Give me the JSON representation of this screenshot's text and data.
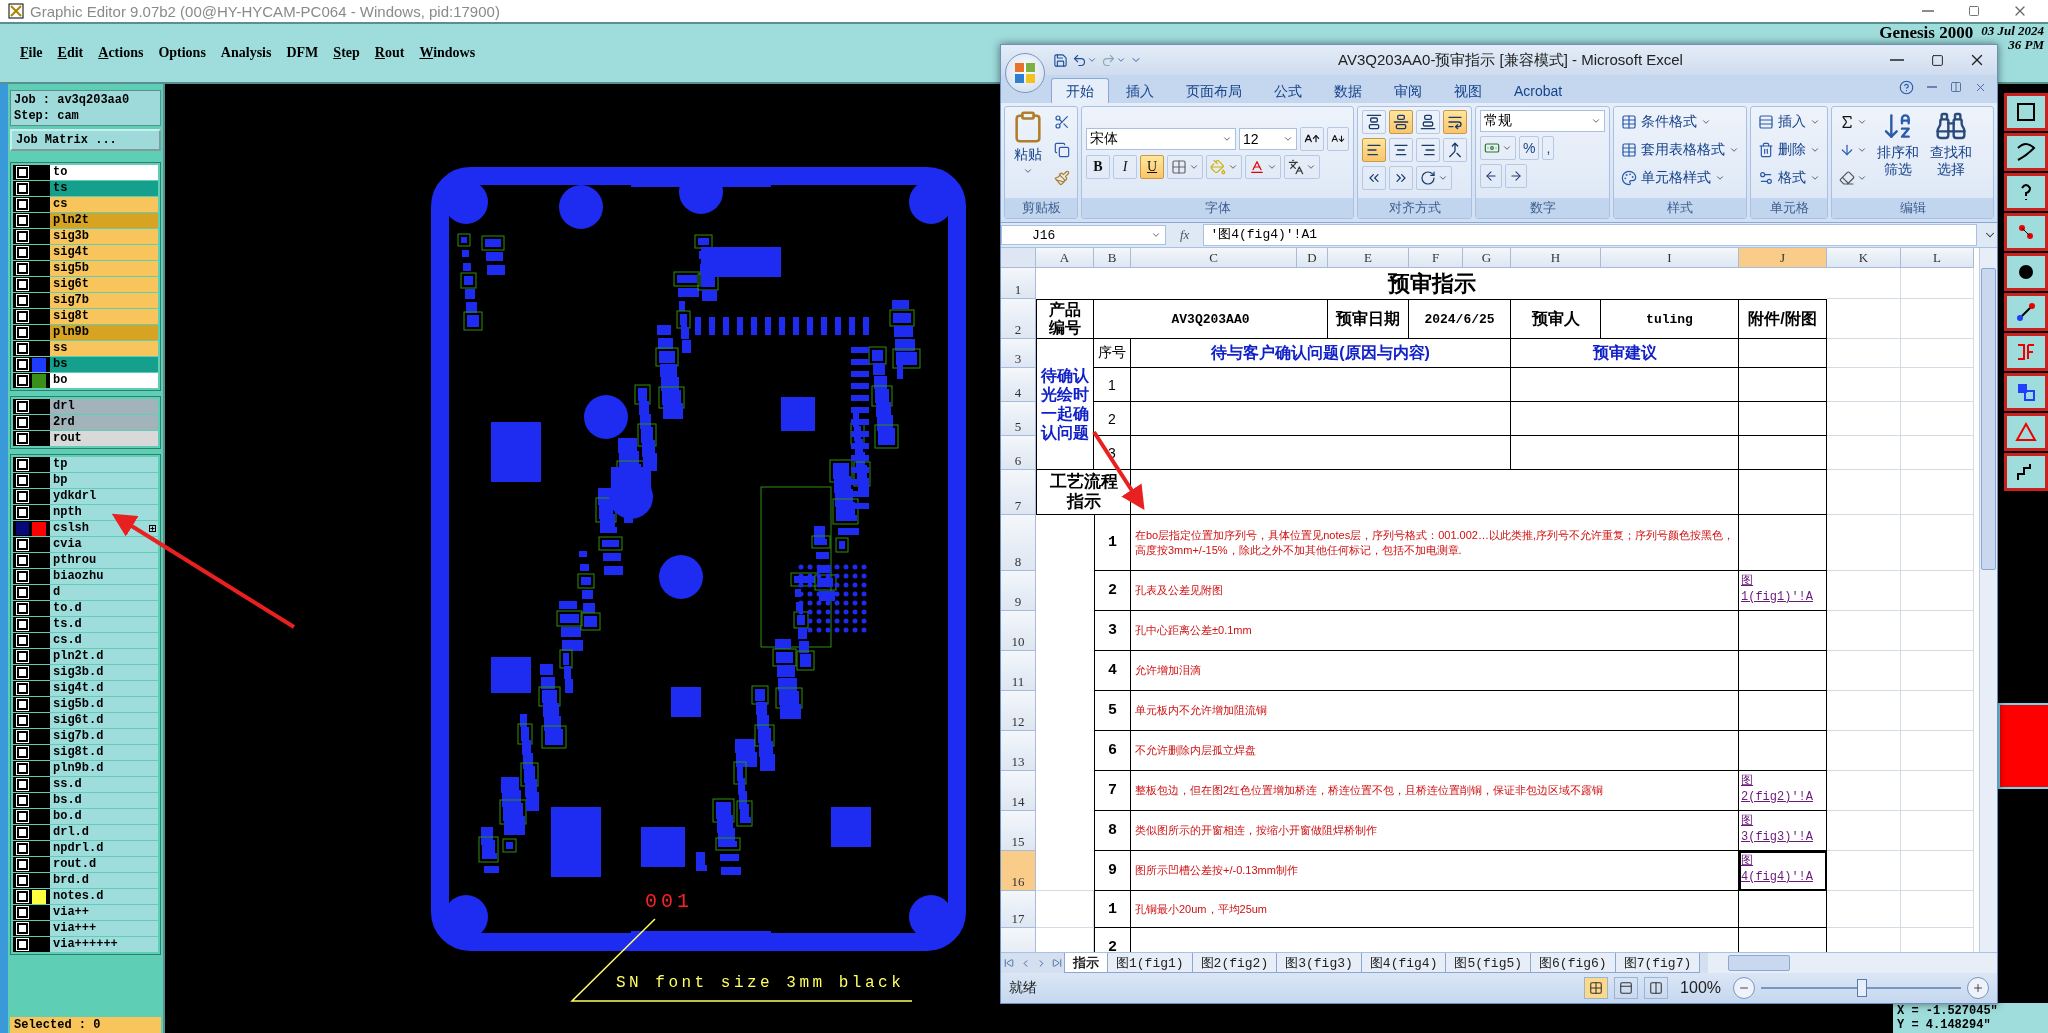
{
  "genesis": {
    "title": "Graphic Editor 9.07b2 (00@HY-HYCAM-PC064 - Windows, pid:17900)",
    "menu": [
      {
        "label": "File",
        "underlined": true
      },
      {
        "label": "Edit",
        "underlined": true
      },
      {
        "label": "Actions",
        "underlined": true
      },
      {
        "label": "Options",
        "underlined": false
      },
      {
        "label": "Analysis",
        "underlined": false
      },
      {
        "label": "DFM",
        "underlined": false
      },
      {
        "label": "Step",
        "underlined": true
      },
      {
        "label": "Rout",
        "underlined": true
      },
      {
        "label": "Windows",
        "underlined": true
      }
    ],
    "brand": {
      "name": "Genesis 2000",
      "date": "03 Jul 2024",
      "time": "36 PM"
    },
    "job": "Job : av3q203aa0",
    "step": "Step: cam",
    "job_matrix_button": "Job Matrix ...",
    "layer_groups": [
      [
        {
          "name": "to",
          "color": "#ffffff",
          "affected": false
        },
        {
          "name": "ts",
          "color": "#14a08c",
          "affected": false
        },
        {
          "name": "cs",
          "color": "#f7c55c",
          "affected": false
        },
        {
          "name": "pln2t",
          "color": "#d6a422",
          "affected": false
        },
        {
          "name": "sig3b",
          "color": "#f7c55c",
          "affected": false
        },
        {
          "name": "sig4t",
          "color": "#f7c55c",
          "affected": false
        },
        {
          "name": "sig5b",
          "color": "#f7c55c",
          "affected": false
        },
        {
          "name": "sig6t",
          "color": "#f7c55c",
          "affected": false
        },
        {
          "name": "sig7b",
          "color": "#f7c55c",
          "affected": false
        },
        {
          "name": "sig8t",
          "color": "#f7c55c",
          "affected": false
        },
        {
          "name": "pln9b",
          "color": "#d6a422",
          "affected": false
        },
        {
          "name": "ss",
          "color": "#f7c55c",
          "affected": false
        },
        {
          "name": "bs",
          "color": "#14a08c",
          "swatch": {
            "color": "#1e3cff"
          },
          "affected": false
        },
        {
          "name": "bo",
          "color": "#ffffff",
          "swatch": {
            "color": "#3a8f18"
          },
          "affected": false
        }
      ],
      [
        {
          "name": "drl",
          "color": "#a3b3bb",
          "affected": false
        },
        {
          "name": "2rd",
          "color": "#a3b3bb",
          "affected": false
        },
        {
          "name": "rout",
          "color": "#d9d9d9",
          "affected": false
        }
      ],
      [
        {
          "name": "tp",
          "color": "#9fdcdc",
          "affected": false
        },
        {
          "name": "bp",
          "color": "#9fdcdc",
          "affected": false
        },
        {
          "name": "ydkdrl",
          "color": "#9fdcdc",
          "affected": false
        },
        {
          "name": "npth",
          "color": "#9fdcdc",
          "affected": false
        },
        {
          "name": "cslsh",
          "color": "#9fdcdc",
          "swatch": {
            "color": "#ff0000"
          },
          "affected": true
        },
        {
          "name": "cvia",
          "color": "#9fdcdc",
          "affected": false
        },
        {
          "name": "pthrou",
          "color": "#9fdcdc",
          "affected": false
        },
        {
          "name": "biaozhu",
          "color": "#9fdcdc",
          "affected": false
        },
        {
          "name": "d",
          "color": "#9fdcdc",
          "affected": false
        },
        {
          "name": "to.d",
          "color": "#9fdcdc",
          "affected": false
        },
        {
          "name": "ts.d",
          "color": "#9fdcdc",
          "affected": false
        },
        {
          "name": "cs.d",
          "color": "#9fdcdc",
          "affected": false
        },
        {
          "name": "pln2t.d",
          "color": "#9fdcdc",
          "affected": false
        },
        {
          "name": "sig3b.d",
          "color": "#9fdcdc",
          "affected": false
        },
        {
          "name": "sig4t.d",
          "color": "#9fdcdc",
          "affected": false
        },
        {
          "name": "sig5b.d",
          "color": "#9fdcdc",
          "affected": false
        },
        {
          "name": "sig6t.d",
          "color": "#9fdcdc",
          "affected": false
        },
        {
          "name": "sig7b.d",
          "color": "#9fdcdc",
          "affected": false
        },
        {
          "name": "sig8t.d",
          "color": "#9fdcdc",
          "affected": false
        },
        {
          "name": "pln9b.d",
          "color": "#9fdcdc",
          "affected": false
        },
        {
          "name": "ss.d",
          "color": "#9fdcdc",
          "affected": false
        },
        {
          "name": "bs.d",
          "color": "#9fdcdc",
          "affected": false
        },
        {
          "name": "bo.d",
          "color": "#9fdcdc",
          "affected": false
        },
        {
          "name": "drl.d",
          "color": "#9fdcdc",
          "affected": false
        },
        {
          "name": "npdrl.d",
          "color": "#9fdcdc",
          "affected": false
        },
        {
          "name": "rout.d",
          "color": "#9fdcdc",
          "affected": false
        },
        {
          "name": "brd.d",
          "color": "#9fdcdc",
          "affected": false
        },
        {
          "name": "notes.d",
          "color": "#9fdcdc",
          "swatch": {
            "color": "#ffff40"
          },
          "affected": false
        },
        {
          "name": "via++",
          "color": "#9fdcdc",
          "affected": false
        },
        {
          "name": "via+++",
          "color": "#9fdcdc",
          "affected": false
        },
        {
          "name": "via++++++",
          "color": "#9fdcdc",
          "affected": false
        }
      ]
    ],
    "selected_count": "Selected : 0",
    "canvas": {
      "serial_mark": "001",
      "note": "SN font size 3mm black"
    },
    "coordinates": {
      "x": "X = -1.527045\"",
      "y": "Y = 4.148294\""
    }
  },
  "excel": {
    "title": "AV3Q203AA0-预审指示  [兼容模式] - Microsoft Excel",
    "tabs": [
      {
        "label": "开始",
        "selected": true
      },
      {
        "label": "插入",
        "selected": false
      },
      {
        "label": "页面布局",
        "selected": false
      },
      {
        "label": "公式",
        "selected": false
      },
      {
        "label": "数据",
        "selected": false
      },
      {
        "label": "审阅",
        "selected": false
      },
      {
        "label": "视图",
        "selected": false
      },
      {
        "label": "Acrobat",
        "selected": false
      }
    ],
    "ribbon": {
      "paste": "粘贴",
      "clipboard_group": "剪贴板",
      "font": "宋体",
      "font_size": "12",
      "style_buttons": [
        {
          "label": "B",
          "on": false
        },
        {
          "label": "I",
          "on": false
        },
        {
          "label": "U",
          "on": true
        }
      ],
      "font_group": "字体",
      "alignment_buttons": [
        {
          "on": false
        },
        {
          "on": true
        },
        {
          "on": false
        },
        {
          "on": true
        },
        {
          "on": true
        },
        {
          "on": false
        },
        {
          "on": false
        },
        {
          "on": false
        }
      ],
      "alignment_group": "对齐方式",
      "number_format": "常规",
      "percent": "%",
      "comma": ",",
      "number_group": "数字",
      "styles": [
        "条件格式",
        "套用表格格式",
        "单元格样式"
      ],
      "styles_group": "样式",
      "cells": [
        "插入",
        "删除",
        "格式"
      ],
      "cells_group": "单元格",
      "sort": "排序和筛选",
      "find": "查找和选择",
      "editing_group": "编辑"
    },
    "name_box": "J16",
    "function_label": "fx",
    "formula": "'图4(fig4)'!A1",
    "columns": [
      {
        "label": "A",
        "selected": false
      },
      {
        "label": "B",
        "selected": false
      },
      {
        "label": "C",
        "selected": false
      },
      {
        "label": "D",
        "selected": false
      },
      {
        "label": "E",
        "selected": false
      },
      {
        "label": "F",
        "selected": false
      },
      {
        "label": "G",
        "selected": false
      },
      {
        "label": "H",
        "selected": false
      },
      {
        "label": "I",
        "selected": false
      },
      {
        "label": "J",
        "selected": true
      },
      {
        "label": "K",
        "selected": false
      },
      {
        "label": "L",
        "selected": false
      }
    ],
    "row_numbers": [
      {
        "label": "1",
        "selected": false
      },
      {
        "label": "2",
        "selected": false
      },
      {
        "label": "3",
        "selected": false
      },
      {
        "label": "4",
        "selected": false
      },
      {
        "label": "5",
        "selected": false
      },
      {
        "label": "6",
        "selected": false
      },
      {
        "label": "7",
        "selected": false
      },
      {
        "label": "8",
        "selected": false
      },
      {
        "label": "9",
        "selected": false
      },
      {
        "label": "10",
        "selected": false
      },
      {
        "label": "11",
        "selected": false
      },
      {
        "label": "12",
        "selected": false
      },
      {
        "label": "13",
        "selected": false
      },
      {
        "label": "14",
        "selected": false
      },
      {
        "label": "15",
        "selected": false
      },
      {
        "label": "16",
        "selected": true
      },
      {
        "label": "17",
        "selected": false
      }
    ],
    "sheet": {
      "title": "预审指示",
      "info": {
        "product_label": "产品编号",
        "product": "AV3Q203AA0",
        "date_label": "预审日期",
        "date": "2024/6/25",
        "reviewer_label": "预审人",
        "reviewer": "tuling",
        "attachment_label": "附件/附图"
      },
      "pending": {
        "label": "待确认光绘时一起确认问题",
        "number_heading": "序号",
        "issue_heading": "待与客户确认问题(原因与内容)",
        "advice_heading": "预审建议",
        "rows": [
          {
            "number": "1"
          },
          {
            "number": "2"
          },
          {
            "number": "3"
          }
        ]
      },
      "process": {
        "label": "工艺流程指示",
        "rows": [
          {
            "number": "1",
            "text": "在bo层指定位置加序列号，具体位置见notes层，序列号格式：001.002…以此类推,序列号不允许重复；序列号颜色按黑色，高度按3mm+/-15%，除此之外不加其他任何标记，包括不加电测章."
          },
          {
            "number": "2",
            "text": "孔表及公差见附图",
            "link": "图1(fig1)'!A"
          },
          {
            "number": "3",
            "text": "孔中心距离公差±0.1mm"
          },
          {
            "number": "4",
            "text": "允许增加泪滴"
          },
          {
            "number": "5",
            "text": "单元板内不允许增加阻流铜"
          },
          {
            "number": "6",
            "text": "不允许删除内层孤立焊盘"
          },
          {
            "number": "7",
            "text": "整板包边，但在图2红色位置增加桥连，桥连位置不包，且桥连位置削铜，保证非包边区域不露铜",
            "link": "图2(fig2)'!A"
          },
          {
            "number": "8",
            "text": "类似图所示的开窗相连，按缩小开窗做阻焊桥制作",
            "link": "图3(fig3)'!A"
          },
          {
            "number": "9",
            "text": "图所示凹槽公差按+/-0.13mm制作",
            "link": "图4(fig4)'!A"
          }
        ]
      },
      "next_section": {
        "rows": [
          {
            "number": "1",
            "text": "孔铜最小20um，平均25um"
          },
          {
            "number": "2"
          }
        ]
      }
    },
    "sheet_tabs": [
      {
        "label": "指示",
        "selected": true
      },
      {
        "label": "图1(fig1)",
        "selected": false
      },
      {
        "label": "图2(fig2)",
        "selected": false
      },
      {
        "label": "图3(fig3)",
        "selected": false
      },
      {
        "label": "图4(fig4)",
        "selected": false
      },
      {
        "label": "图5(fig5)",
        "selected": false
      },
      {
        "label": "图6(fig6)",
        "selected": false
      },
      {
        "label": "图7(fig7)",
        "selected": false
      }
    ],
    "status": "就绪",
    "zoom": "100%",
    "zoom_slider": {
      "level": 0.5
    }
  }
}
